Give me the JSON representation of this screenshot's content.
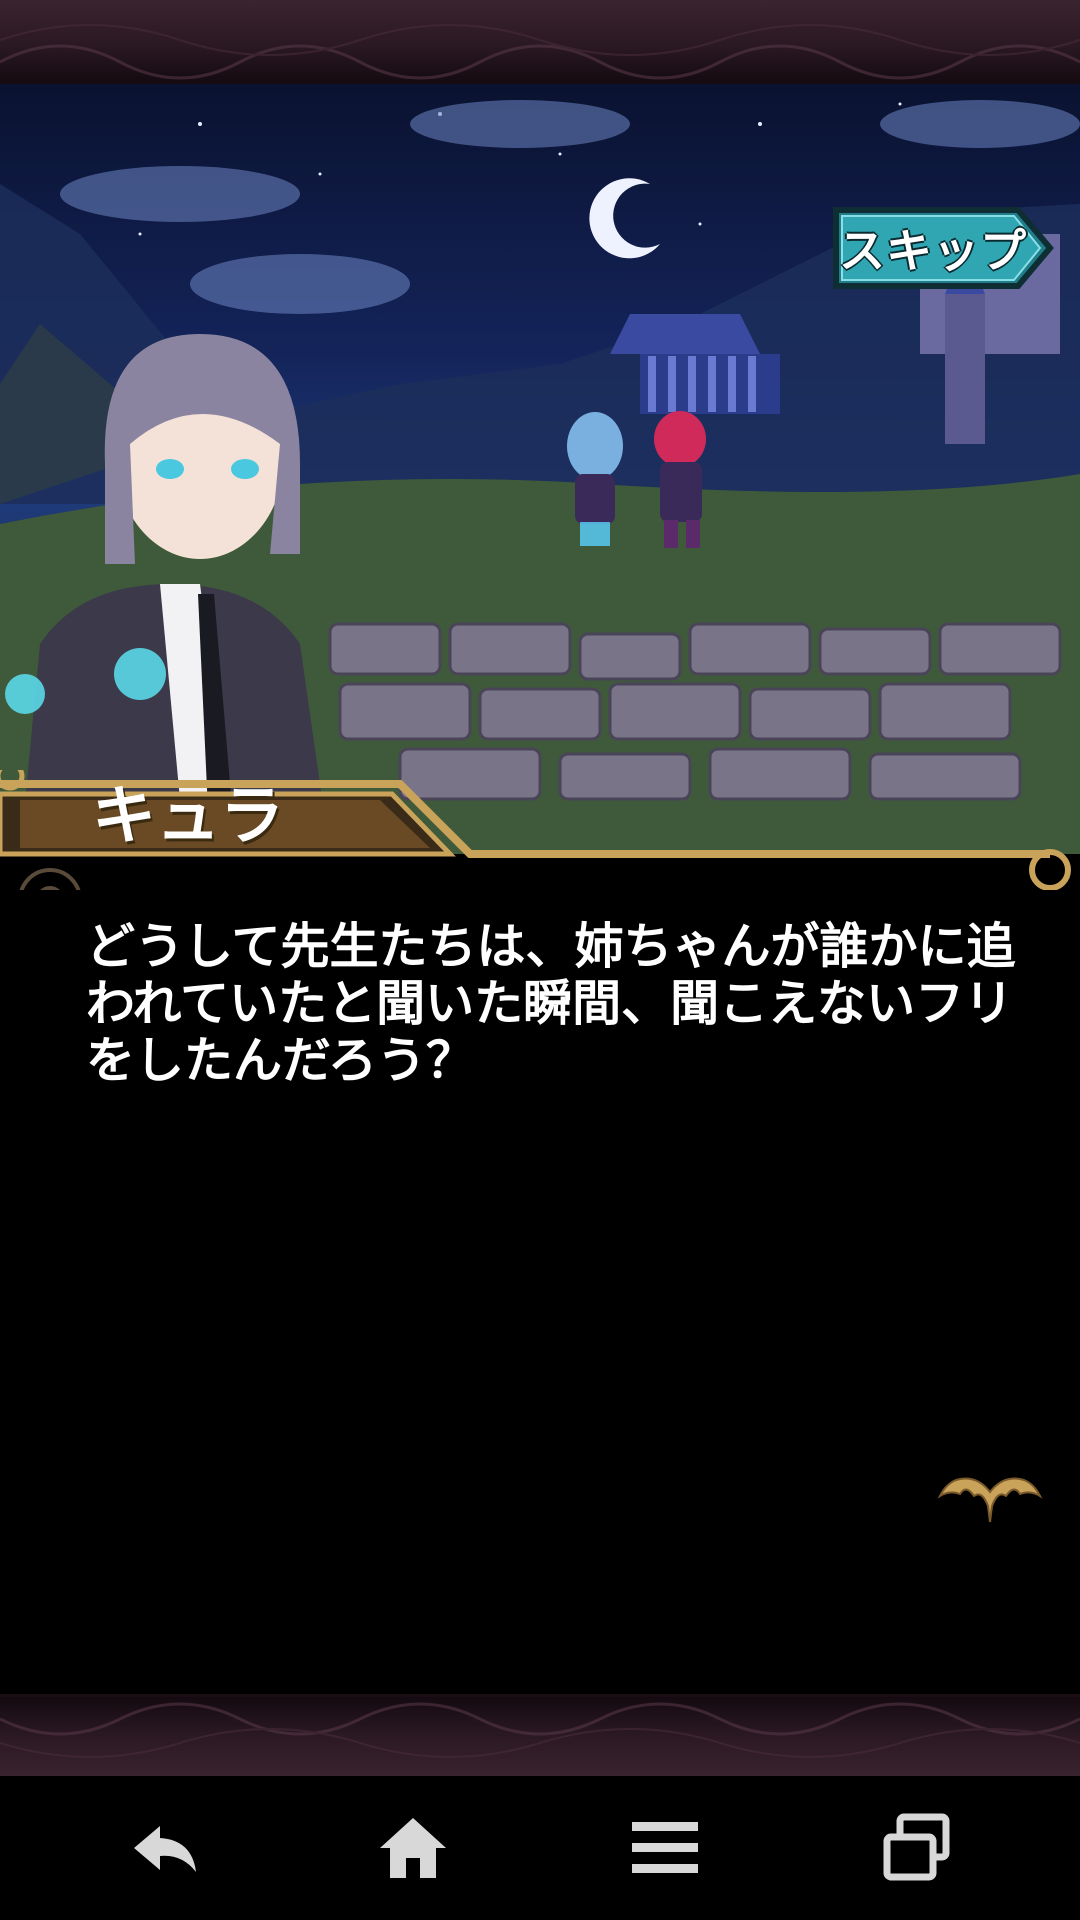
{
  "skip": {
    "label": "スキップ"
  },
  "speaker": {
    "name": "キュラ"
  },
  "dialogue": {
    "text": "どうして先生たちは、姉ちゃんが誰かに追われていたと聞いた瞬間、聞こえないフリをしたんだろう？"
  },
  "colors": {
    "gold": "#c9a35a",
    "skip_teal": "#2a9aa6",
    "frame_maroon": "#2a1822"
  },
  "navbar": {
    "items": [
      {
        "icon": "back-icon"
      },
      {
        "icon": "home-icon"
      },
      {
        "icon": "menu-icon"
      },
      {
        "icon": "recent-apps-icon"
      }
    ]
  }
}
